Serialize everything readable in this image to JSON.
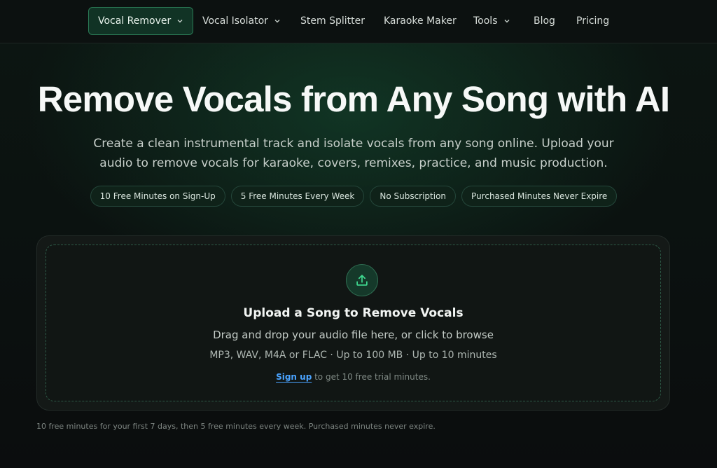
{
  "nav": {
    "items": [
      {
        "label": "Vocal Remover",
        "has_dropdown": true,
        "active": true
      },
      {
        "label": "Vocal Isolator",
        "has_dropdown": true,
        "active": false
      },
      {
        "label": "Stem Splitter",
        "has_dropdown": false,
        "active": false
      },
      {
        "label": "Karaoke Maker",
        "has_dropdown": false,
        "active": false
      },
      {
        "label": "Tools",
        "has_dropdown": true,
        "active": false
      },
      {
        "label": "Blog",
        "has_dropdown": false,
        "active": false
      },
      {
        "label": "Pricing",
        "has_dropdown": false,
        "active": false
      }
    ]
  },
  "hero": {
    "title": "Remove Vocals from Any Song with AI",
    "subtitle": "Create a clean instrumental track and isolate vocals from any song online. Upload your audio to remove vocals for karaoke, covers, remixes, practice, and music production.",
    "pills": [
      "10 Free Minutes on Sign-Up",
      "5 Free Minutes Every Week",
      "No Subscription",
      "Purchased Minutes Never Expire"
    ]
  },
  "upload": {
    "icon": "upload-icon",
    "title": "Upload a Song to Remove Vocals",
    "description": "Drag and drop your audio file here, or click to browse",
    "formats": "MP3, WAV, M4A or FLAC · Up to 100 MB · Up to 10 minutes",
    "signup_link": "Sign up",
    "signup_rest": " to get 10 free trial minutes."
  },
  "footnote": "10 free minutes for your first 7 days, then 5 free minutes every week. Purchased minutes never expire.",
  "colors": {
    "accent": "#2a7a55",
    "link": "#4aa3ff",
    "background": "#0b1210"
  }
}
